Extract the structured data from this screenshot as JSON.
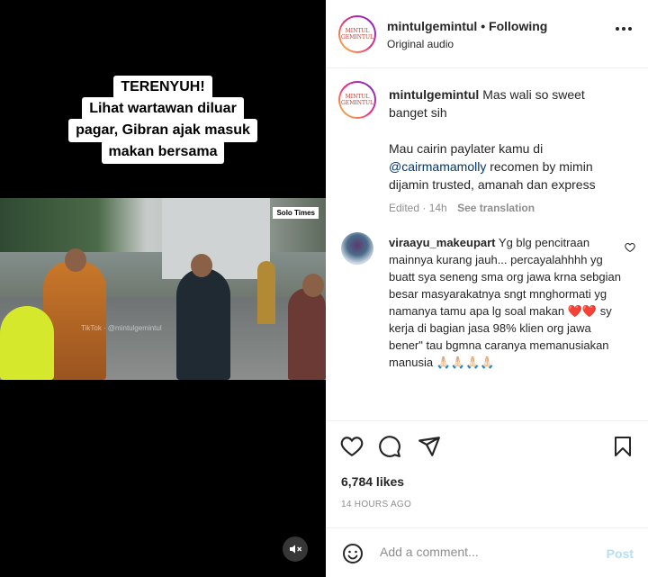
{
  "video": {
    "caption_lines": [
      "TERENYUH!",
      "Lihat wartawan diluar",
      "pagar, Gibran ajak masuk",
      "makan bersama"
    ],
    "watermark": "Solo Times",
    "tiktok_handle": "TikTok · @mintulgemintul",
    "mute_icon": "speaker-muted-icon"
  },
  "header": {
    "username": "mintulgemintul",
    "separator": "•",
    "follow_status": "Following",
    "audio": "Original audio",
    "avatar_text": "MINTUL GEMINTUL"
  },
  "caption": {
    "username": "mintulgemintul",
    "text1": "Mas wali so sweet banget sih",
    "text2_pre": "Mau cairin paylater kamu di",
    "mention": "@cairmamamolly",
    "text2_post": "recomen by mimin dijamin trusted, amanah dan express",
    "edited": "Edited · 14h",
    "see_translation": "See translation"
  },
  "comment": {
    "username": "viraayu_makeupart",
    "text": "Yg blg pencitraan mainnya kurang jauh... percayalahhhh yg buatt sya seneng sma org jawa krna sebgian besar masyarakatnya sngt mnghormati yg namanya tamu apa lg soal makan ❤️❤️ sy kerja di bagian jasa 98% klien org jawa bener\" tau bgmna caranya memanusiakan manusia 🙏🏻🙏🏻🙏🏻🙏🏻"
  },
  "actions": {
    "likes": "6,784 likes",
    "time": "14 HOURS AGO"
  },
  "add_comment": {
    "placeholder": "Add a comment...",
    "post": "Post"
  }
}
